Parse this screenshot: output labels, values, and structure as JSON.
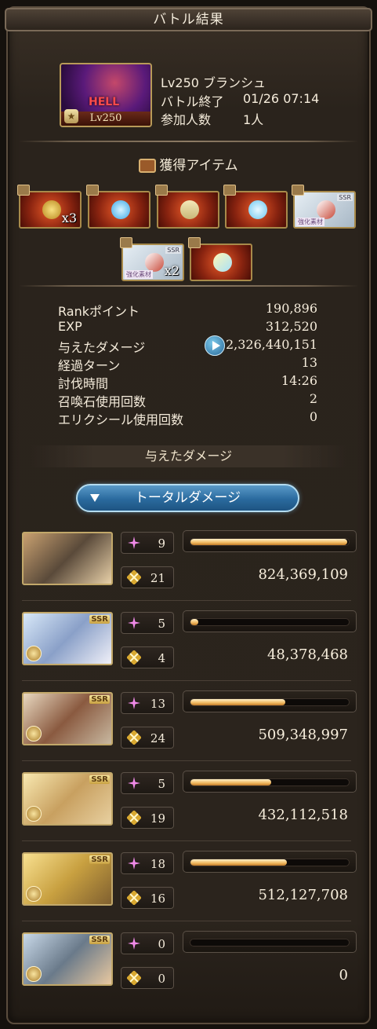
{
  "title": "バトル結果",
  "quest": {
    "difficulty": "HELL",
    "thumb_level": "Lv250",
    "name_line": "Lv250 ブランシュ",
    "end_label": "バトル終了",
    "end_time": "01/26 07:14",
    "participants_label": "参加人数",
    "participants": "1人"
  },
  "items_section": {
    "title": "獲得アイテム"
  },
  "items": [
    {
      "name": "coin",
      "count": "x3",
      "tag": "",
      "ssr": ""
    },
    {
      "name": "orb",
      "count": "",
      "tag": "",
      "ssr": ""
    },
    {
      "name": "scroll",
      "count": "",
      "tag": "",
      "ssr": ""
    },
    {
      "name": "crystal",
      "count": "",
      "tag": "",
      "ssr": ""
    },
    {
      "name": "weapon",
      "count": "",
      "tag": "強化素材",
      "ssr": "SSR"
    },
    {
      "name": "weapon2",
      "count": "x2",
      "tag": "強化素材",
      "ssr": "SSR"
    },
    {
      "name": "gem",
      "count": "",
      "tag": "",
      "ssr": ""
    }
  ],
  "stats": [
    {
      "label": "Rankポイント",
      "value": "190,896"
    },
    {
      "label": "EXP",
      "value": "312,520"
    },
    {
      "label": "与えたダメージ",
      "value": "2,326,440,151"
    },
    {
      "label": "経過ターン",
      "value": "13"
    },
    {
      "label": "討伐時間",
      "value": "14:26"
    },
    {
      "label": "召喚石使用回数",
      "value": "2"
    },
    {
      "label": "エリクシール使用回数",
      "value": "0"
    }
  ],
  "damage_section": {
    "title": "与えたダメージ",
    "total_button": "トータルダメージ"
  },
  "characters": [
    {
      "name": "main-character",
      "ssr": "",
      "skill": "9",
      "ougi": "21",
      "bar_fraction": 0.99,
      "damage": "824,369,109"
    },
    {
      "name": "character-2",
      "ssr": "SSR",
      "skill": "5",
      "ougi": "4",
      "bar_fraction": 0.03,
      "damage": "48,378,468"
    },
    {
      "name": "character-3",
      "ssr": "SSR",
      "skill": "13",
      "ougi": "24",
      "bar_fraction": 0.6,
      "damage": "509,348,997"
    },
    {
      "name": "character-4",
      "ssr": "SSR",
      "skill": "5",
      "ougi": "19",
      "bar_fraction": 0.51,
      "damage": "432,112,518"
    },
    {
      "name": "character-5",
      "ssr": "SSR",
      "skill": "18",
      "ougi": "16",
      "bar_fraction": 0.61,
      "damage": "512,127,708"
    },
    {
      "name": "character-6",
      "ssr": "SSR",
      "skill": "0",
      "ougi": "0",
      "bar_fraction": 0.0,
      "damage": "0"
    }
  ],
  "colors": {
    "accent": "#f0b860",
    "button": "#2a6a9e",
    "frame": "#2b241d"
  }
}
